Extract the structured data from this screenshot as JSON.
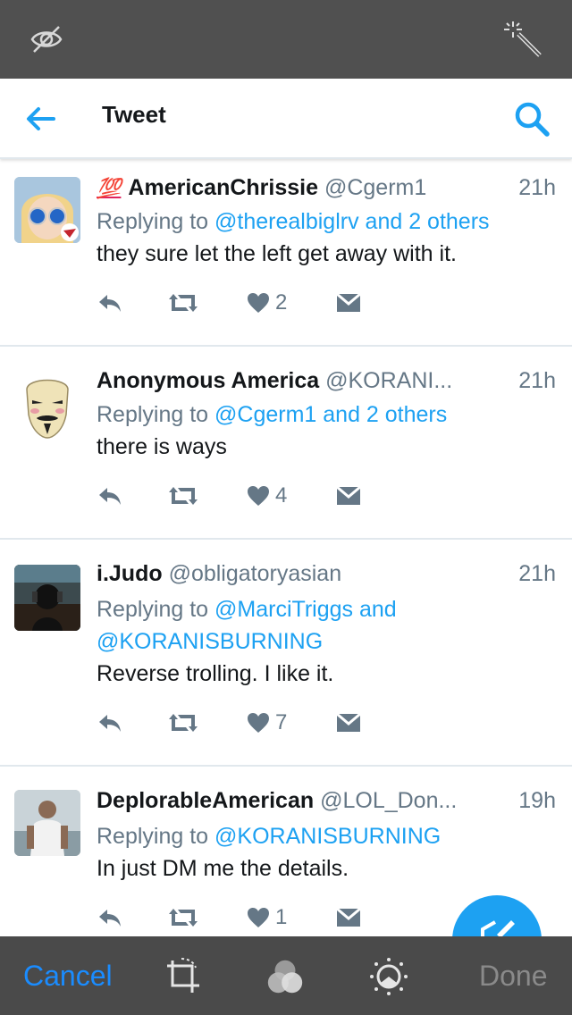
{
  "editor_top": {
    "hide_icon": "eye-slash-icon",
    "enhance_icon": "magic-wand-icon"
  },
  "header": {
    "title": "Tweet",
    "back_icon": "back-arrow-icon",
    "search_icon": "search-icon"
  },
  "colors": {
    "twitter_blue": "#1da1f2",
    "gray_text": "#657786",
    "divider": "#e1e8ed",
    "editor_bar": "#4a4a4a",
    "ios_blue": "#1a8cff"
  },
  "tweets": [
    {
      "badge": "💯",
      "name": "AmericanChrissie",
      "handle": "@Cgerm1",
      "time": "21h",
      "replying_prefix": "Replying to ",
      "replying_to_1": "@therealbiglrv and 2 others",
      "replying_to_2": "",
      "text": "they sure let the left get away with it.",
      "likes": "2"
    },
    {
      "name": "Anonymous America",
      "handle": "@KORANI...",
      "time": "21h",
      "replying_prefix": "Replying to ",
      "replying_to_1": "@Cgerm1 and 2 others",
      "replying_to_2": "",
      "text": "there is ways",
      "likes": "4"
    },
    {
      "name": "i.Judo",
      "handle": "@obligatoryasian",
      "time": "21h",
      "replying_prefix": "Replying to ",
      "replying_to_1": "@MarciTriggs and",
      "replying_to_2": "@KORANISBURNING",
      "text": "Reverse trolling. I like it.",
      "likes": "7"
    },
    {
      "name": "DeplorableAmerican",
      "handle": "@LOL_Don...",
      "time": "19h",
      "replying_prefix": "Replying to ",
      "replying_to_1": "@KORANISBURNING",
      "replying_to_2": "",
      "text": "In just DM me the details.",
      "likes": "1"
    }
  ],
  "editor_bottom": {
    "cancel_label": "Cancel",
    "done_label": "Done",
    "crop_icon": "crop-rotate-icon",
    "filters_icon": "filters-icon",
    "adjust_icon": "adjust-dial-icon"
  },
  "fab_icon": "compose-tweet-icon"
}
